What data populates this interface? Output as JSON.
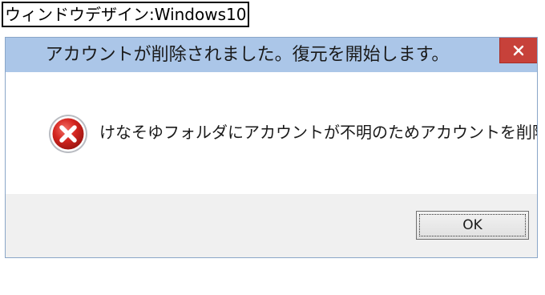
{
  "caption": {
    "text": "ウィンドウデザイン:Windows10"
  },
  "dialog": {
    "title": "アカウントが削除されました。復元を開始します。",
    "close_glyph": "✕",
    "icon": "error-icon",
    "message": "けなそゆフォルダにアカウントが不明のためアカウントを削除します",
    "ok_label": "OK"
  },
  "colors": {
    "titlebar": "#abc6e8",
    "close_button": "#c7413a",
    "footer": "#f0f0f0",
    "error_red": "#d4251f"
  }
}
